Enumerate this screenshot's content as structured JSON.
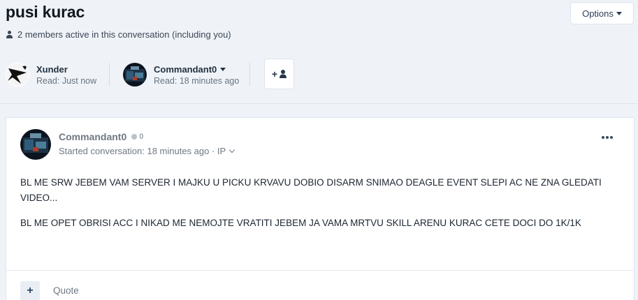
{
  "conversation": {
    "title": "pusi kurac",
    "options_label": "Options",
    "members_text": "2 members active in this conversation (including you)",
    "participants": [
      {
        "name": "Xunder",
        "read": "Read: Just now"
      },
      {
        "name": "Commandant0",
        "read": "Read: 18 minutes ago"
      }
    ],
    "add_participant_label": "+"
  },
  "post": {
    "author": "Commandant0",
    "reputation": "0",
    "meta": "Started conversation: 18 minutes ago · IP",
    "paragraphs": [
      "BL ME SRW JEBEM VAM SERVER I MAJKU U PICKU KRVAVU DOBIO DISARM SNIMAO DEAGLE EVENT SLEPI AC NE ZNA GLEDATI VIDEO...",
      "BL ME OPET OBRISI ACC I NIKAD ME NEMOJTE VRATITI JEBEM JA VAMA MRTVU SKILL ARENU KURAC CETE DOCI DO 1K/1K"
    ],
    "multiquote_label": "+",
    "quote_label": "Quote"
  },
  "colors": {
    "background": "#eff3f8",
    "accent": "#2a4566"
  }
}
